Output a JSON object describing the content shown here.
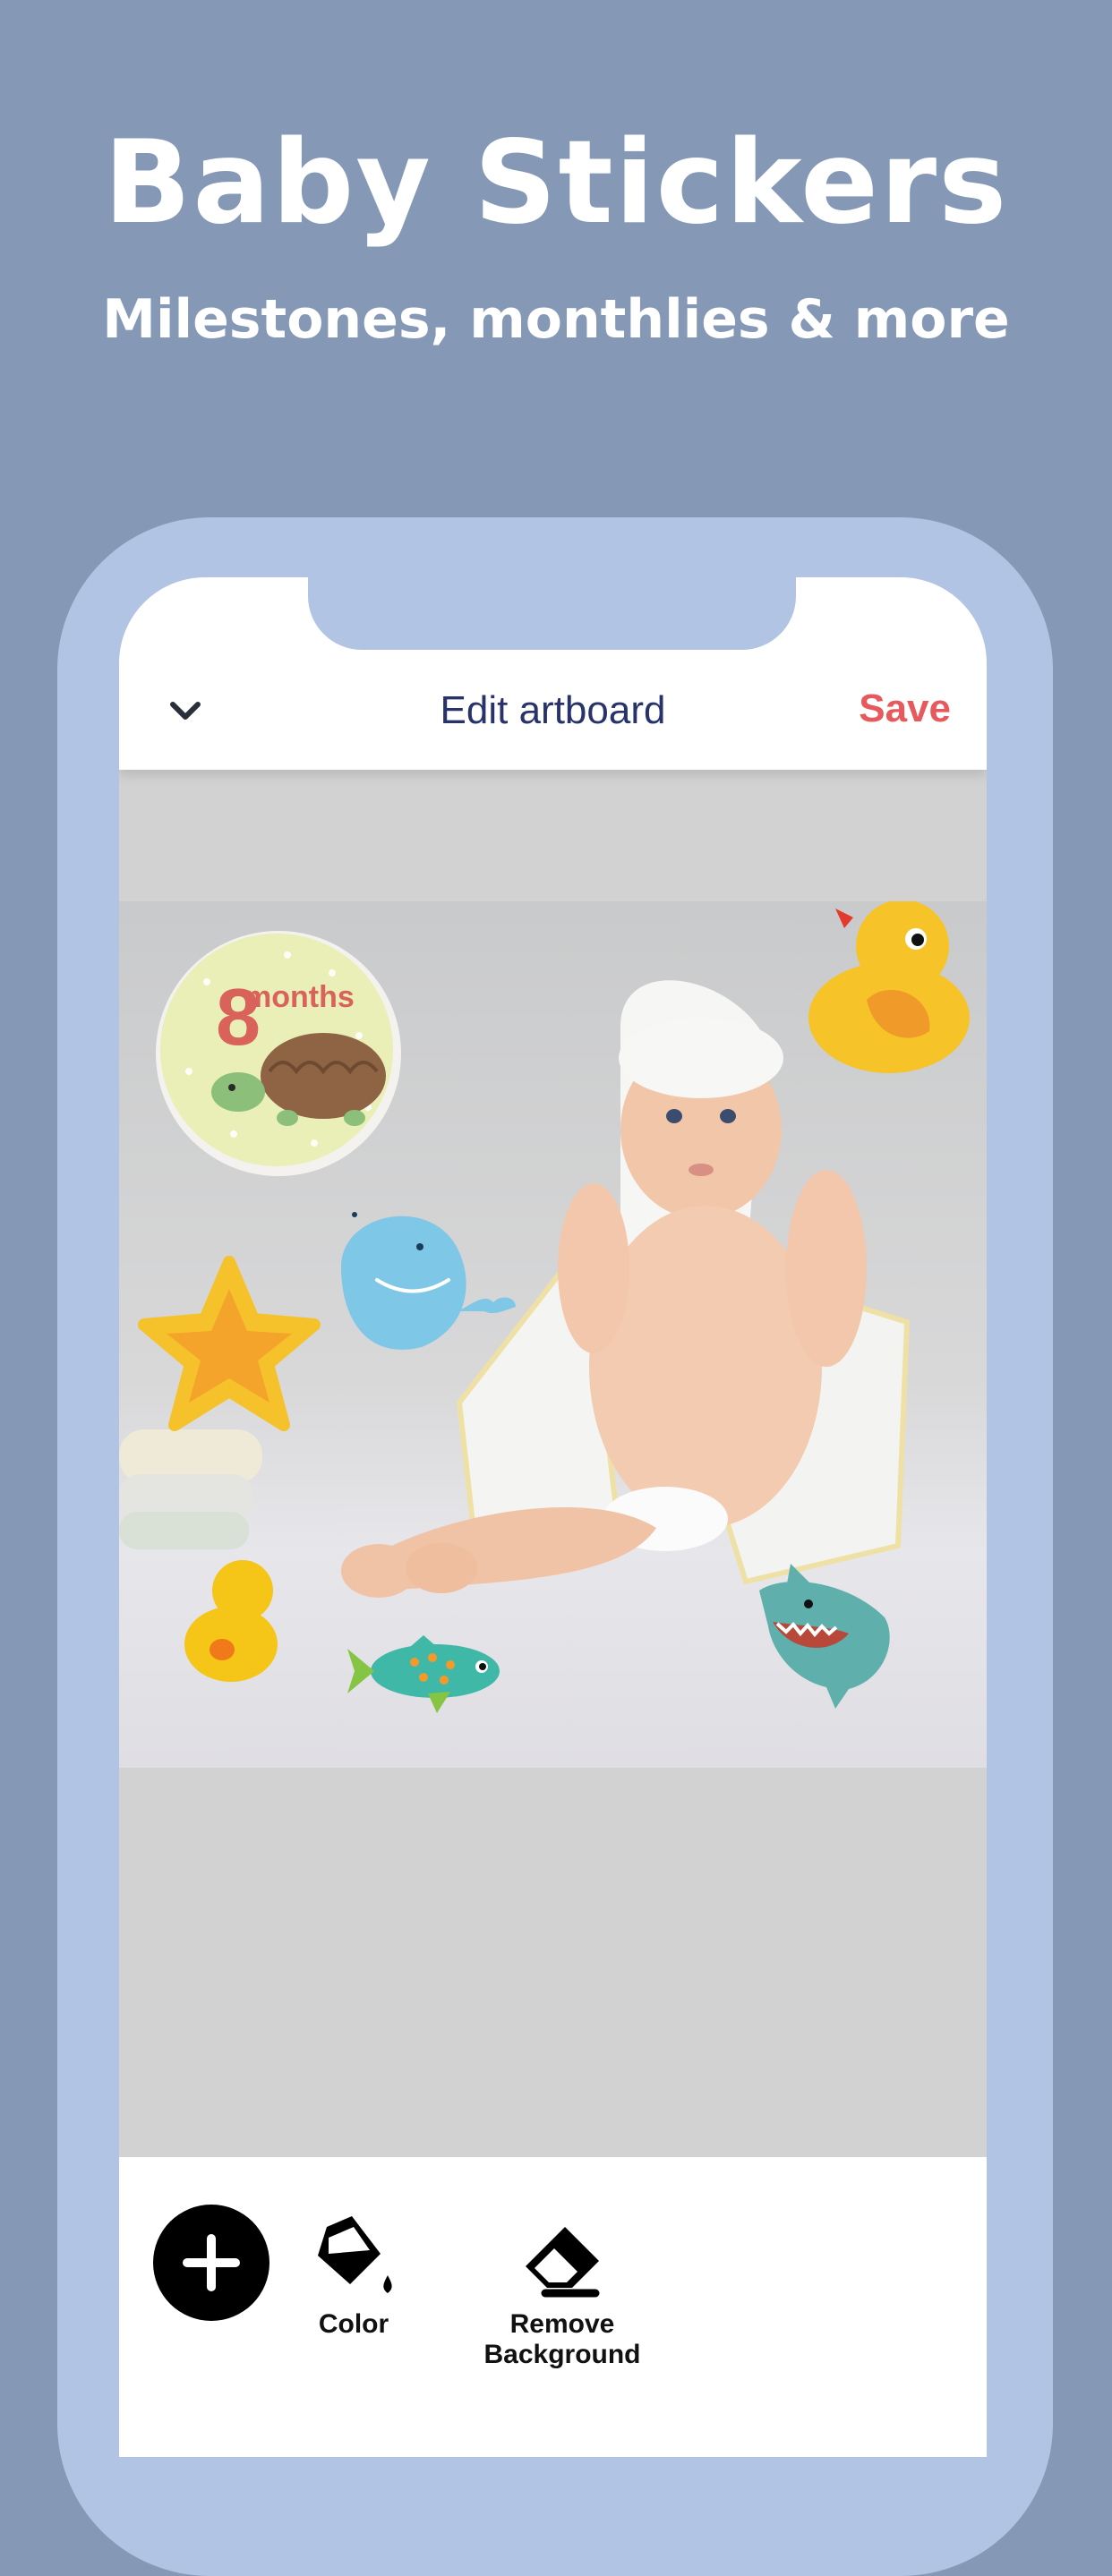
{
  "promo": {
    "headline": "Baby Stickers",
    "subline": "Milestones, monthlies & more"
  },
  "navbar": {
    "title": "Edit artboard",
    "save_label": "Save",
    "back_icon": "chevron-down-icon"
  },
  "artboard": {
    "milestone_sticker": {
      "number": "8",
      "word": "months"
    }
  },
  "toolbar": {
    "add_icon": "plus-icon",
    "color_label": "Color",
    "remove_bg_label": "Remove Background"
  },
  "colors": {
    "background": "#8599b6",
    "phone": "#b1c4e3",
    "title": "#27336a",
    "save": "#e6595d"
  }
}
